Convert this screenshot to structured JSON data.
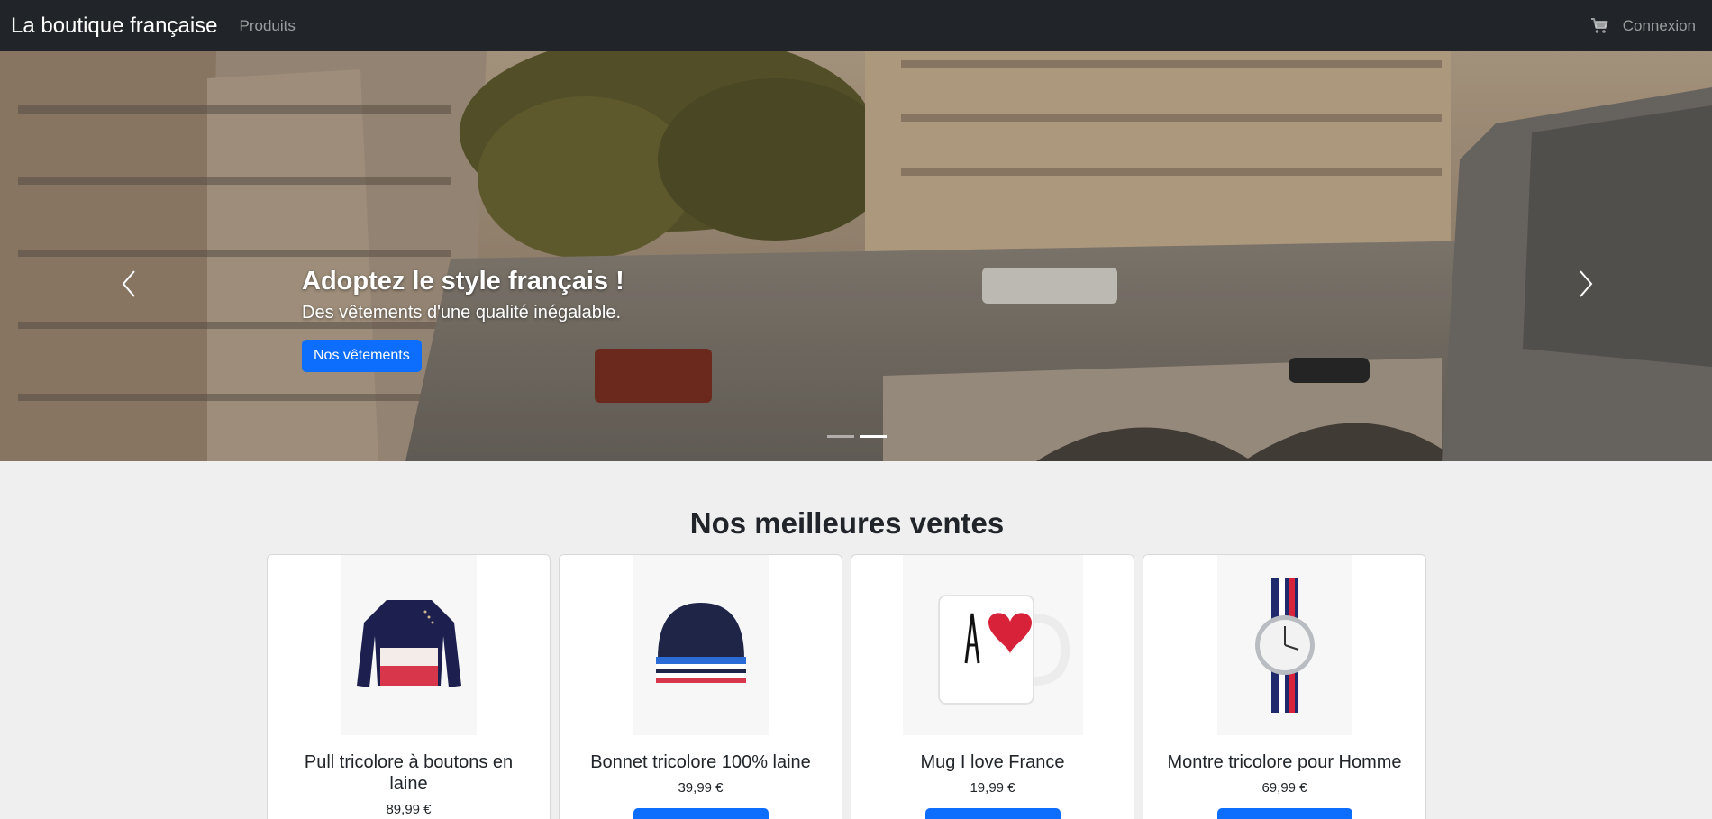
{
  "navbar": {
    "brand": "La boutique française",
    "products_link": "Produits",
    "login_link": "Connexion"
  },
  "hero": {
    "title": "Adoptez le style français !",
    "subtitle": "Des vêtements d'une qualité inégalable.",
    "button": "Nos vêtements",
    "slide_count": 2,
    "active_slide": 2
  },
  "best_sellers": {
    "title": "Nos meilleures ventes",
    "products": [
      {
        "name": "Pull tricolore à boutons en laine",
        "price": "89,99 €",
        "image": "sweater-image"
      },
      {
        "name": "Bonnet tricolore 100% laine",
        "price": "39,99 €",
        "image": "beanie-image"
      },
      {
        "name": "Mug I love France",
        "price": "19,99 €",
        "image": "mug-image"
      },
      {
        "name": "Montre tricolore pour Homme",
        "price": "69,99 €",
        "image": "watch-image"
      }
    ]
  },
  "colors": {
    "navbar": "#212529",
    "primary": "#0d6efd",
    "page_bg": "#efefef"
  }
}
